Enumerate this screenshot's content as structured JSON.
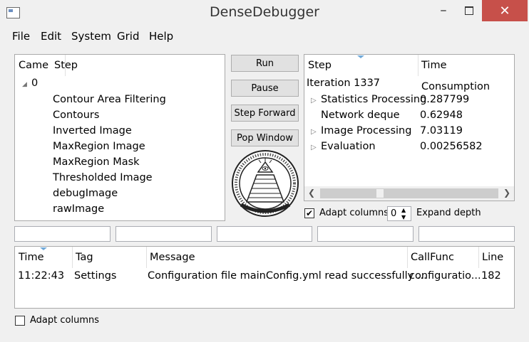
{
  "window": {
    "title": "DenseDebugger"
  },
  "menu": [
    "File",
    "Edit",
    "System",
    "Grid",
    "Help"
  ],
  "left_tree": {
    "columns": [
      "Came",
      "Step"
    ],
    "root": "0",
    "children": [
      "Contour Area Filtering",
      "Contours",
      "Inverted Image",
      "MaxRegion Image",
      "MaxRegion Mask",
      "Thresholded Image",
      "debugImage",
      "rawImage"
    ]
  },
  "buttons": {
    "run": "Run",
    "pause": "Pause",
    "step_forward": "Step Forward",
    "pop_window": "Pop Window"
  },
  "right_tree": {
    "columns": [
      "Step",
      "Time Consumption"
    ],
    "root": "Iteration 1337",
    "rows": [
      {
        "name": "Statistics Processing",
        "time": "0.287799",
        "expandable": true
      },
      {
        "name": "Network deque",
        "time": "0.62948",
        "expandable": false
      },
      {
        "name": "Image Processing",
        "time": "7.03119",
        "expandable": true
      },
      {
        "name": "Evaluation",
        "time": "0.00256582",
        "expandable": true
      }
    ]
  },
  "controls": {
    "adapt_columns": "Adapt columns",
    "expand_depth_value": "0",
    "expand_depth_label": "Expand depth"
  },
  "log": {
    "columns": [
      "Time",
      "Tag",
      "Message",
      "CallFunc",
      "Line"
    ],
    "rows": [
      {
        "time": "11:22:43",
        "tag": "Settings",
        "message": "Configuration file mainConfig.yml read successfully ...",
        "callfunc": "configuratio...",
        "line": "182"
      }
    ]
  },
  "bottom": {
    "adapt_columns": "Adapt columns"
  }
}
